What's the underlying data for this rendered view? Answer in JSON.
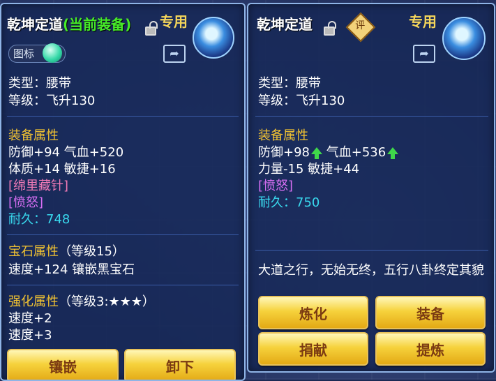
{
  "left": {
    "title": "乾坤定道",
    "title_suffix": "(当前装备)",
    "exclusive": "专用",
    "icon_toggle_label": "图标",
    "type_line": "类型：腰带",
    "level_line": "等级：飞升130",
    "attr_header": "装备属性",
    "attr1": "防御+94 气血+520",
    "attr2": "体质+14 敏捷+16",
    "special1": "[绵里藏针]",
    "special2": "[愤怒]",
    "durability": "耐久：748",
    "gem_header": "宝石属性",
    "gem_level": "（等级15）",
    "gem_line": "速度+124 镶嵌黑宝石",
    "enh_header": "强化属性",
    "enh_level": "（等级3:★★★）",
    "enh1": "速度+2",
    "enh2": "速度+3",
    "btn_inlay": "镶嵌",
    "btn_unequip": "卸下"
  },
  "right": {
    "title": "乾坤定道",
    "rate_label": "评",
    "exclusive": "专用",
    "type_line": "类型：腰带",
    "level_line": "等级：飞升130",
    "attr_header": "装备属性",
    "attr_def": "防御+98",
    "attr_hp": "气血+536",
    "attr2": "力量-15 敏捷+44",
    "special1": "[愤怒]",
    "durability": "耐久：750",
    "desc": "大道之行，无始无终，五行八卦终定其貌",
    "btn_refine": "炼化",
    "btn_equip": "装备",
    "btn_donate": "捐献",
    "btn_extract": "提炼"
  },
  "colors": {
    "title": "#ffffff",
    "current_equip": "#46ea28",
    "section_header": "#f1c232",
    "durability": "#39d9ee",
    "special_pink": "#f07ab6",
    "special_purple": "#d66ef2",
    "button_text": "#7b3b12"
  },
  "icons": [
    "lock-icon",
    "share-icon",
    "equipment-badge-icon",
    "toggle-orb-icon",
    "up-arrow-icon"
  ]
}
